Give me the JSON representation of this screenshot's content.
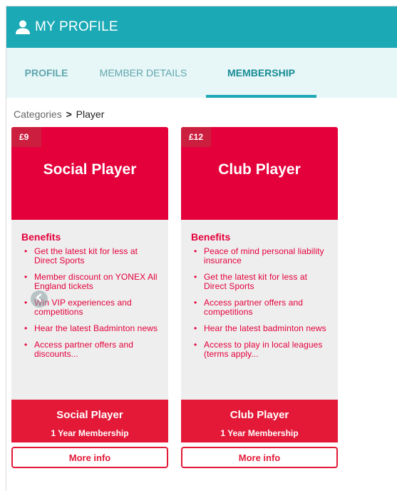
{
  "header": {
    "title": "MY PROFILE",
    "icon": "user-icon",
    "color": "#1aa9b5"
  },
  "tabs": [
    {
      "label": "PROFILE"
    },
    {
      "label": "MEMBER DETAILS"
    },
    {
      "label": "MEMBERSHIP",
      "active": true
    }
  ],
  "breadcrumb": {
    "root": "Categories",
    "separator": ">",
    "current": "Player"
  },
  "cards": [
    {
      "price": "£9",
      "title": "Social Player",
      "benefits_title": "Benefits",
      "benefits": [
        "Get the latest kit for less at Direct Sports",
        "Member discount on YONEX All England tickets",
        "Win VIP experiences and competitions",
        "Hear the latest Badminton news",
        "Access partner offers and discounts..."
      ],
      "footer_title": "Social Player",
      "footer_sub": "1 Year Membership",
      "button": "More info"
    },
    {
      "price": "£12",
      "title": "Club Player",
      "benefits_title": "Benefits",
      "benefits": [
        "Peace of mind personal liability insurance",
        "Get the latest kit for less at Direct Sports",
        "Access partner offers and competitions",
        "Hear the latest badminton news",
        "Access to play in local leagues (terms apply..."
      ],
      "footer_title": "Club Player",
      "footer_sub": "1 Year Membership",
      "button": "More info"
    }
  ],
  "carousel": {
    "prev_icon": "chevron-left-icon"
  },
  "colors": {
    "accent": "#1aa9b5",
    "brand_red": "#e4003b"
  }
}
